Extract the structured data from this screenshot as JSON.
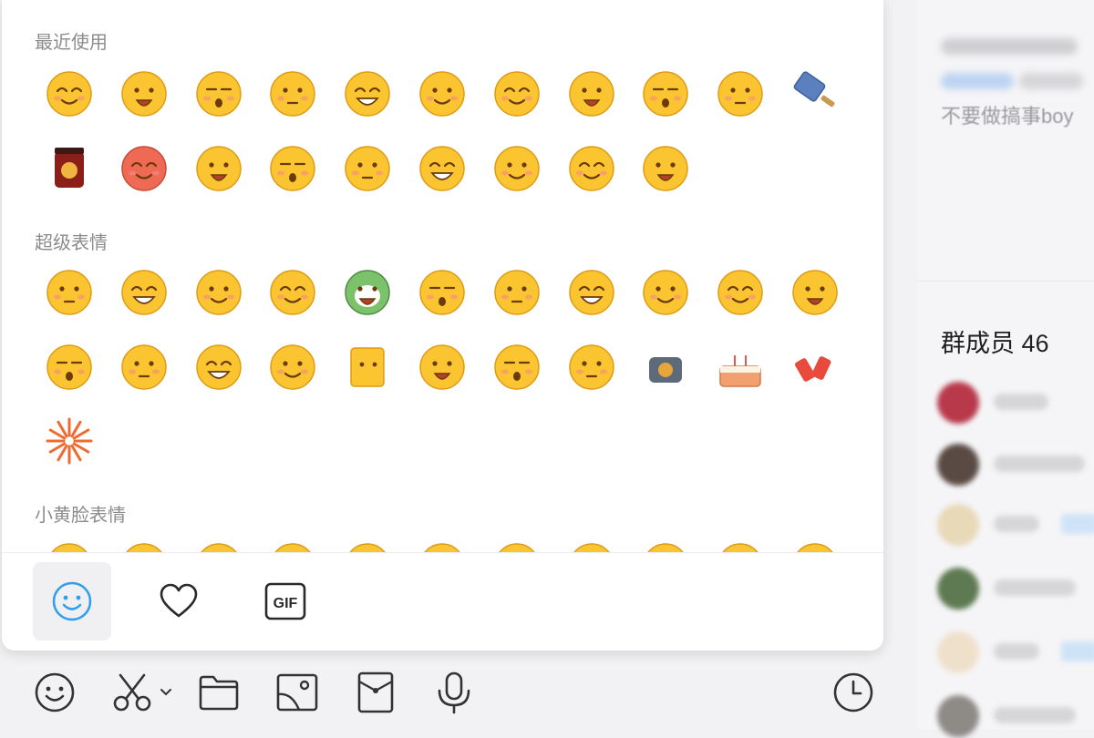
{
  "sidebar": {
    "visible_text": "不要做搞事boy",
    "members_title": "群成员 46"
  },
  "emoji_panel": {
    "sections": [
      {
        "title": "最近使用",
        "count": 20
      },
      {
        "title": "超级表情",
        "count": 23
      },
      {
        "title": "小黄脸表情",
        "count": 11
      }
    ],
    "tabs": [
      {
        "name": "emoji-tab",
        "icon": "smiley-icon",
        "active": true
      },
      {
        "name": "favorites-tab",
        "icon": "heart-icon",
        "active": false
      },
      {
        "name": "gif-tab",
        "icon": "gif-icon",
        "label": "GIF",
        "active": false
      }
    ]
  },
  "toolbar": {
    "items": [
      "emoji-icon",
      "scissors-icon",
      "folder-icon",
      "image-icon",
      "red-packet-icon",
      "microphone-icon",
      "clock-icon"
    ]
  },
  "colors": {
    "emoji_yellow": "#fbc531",
    "emoji_outline": "#e09b16",
    "active_tab_icon": "#2fa0f0",
    "icon_dark": "#333333"
  }
}
